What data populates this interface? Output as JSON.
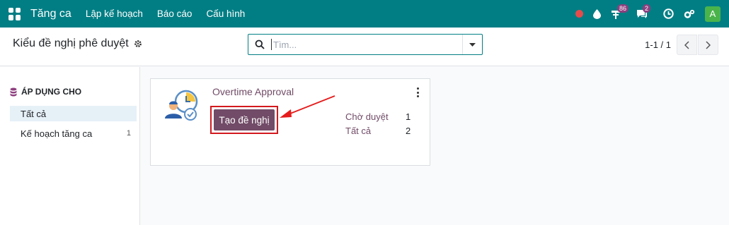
{
  "navbar": {
    "app_name": "Tăng ca",
    "menu": [
      "Lập kế hoạch",
      "Báo cáo",
      "Cấu hình"
    ],
    "activity_count": "86",
    "message_count": "2",
    "user_initial": "A",
    "icons": [
      "apps-icon",
      "record-icon",
      "drop-icon",
      "activity-icon",
      "chat-icon",
      "clock-icon",
      "settings-icon"
    ]
  },
  "control_panel": {
    "breadcrumb": "Kiểu đề nghị phê duyệt",
    "search_placeholder": "Tìm...",
    "pager": "1-1 / 1"
  },
  "sidebar": {
    "section_title": "ÁP DỤNG CHO",
    "items": [
      {
        "label": "Tất cả",
        "count": "",
        "active": true
      },
      {
        "label": "Kế hoạch tăng ca",
        "count": "1",
        "active": false
      }
    ]
  },
  "card": {
    "title": "Overtime Approval",
    "create_button": "Tạo đề nghị",
    "stats": [
      {
        "label": "Chờ duyệt",
        "value": "1"
      },
      {
        "label": "Tất cả",
        "value": "2"
      }
    ]
  },
  "colors": {
    "navbar": "#017e84",
    "primary": "#714b67",
    "highlight": "#d3191e",
    "badge": "#8d3f7f"
  }
}
